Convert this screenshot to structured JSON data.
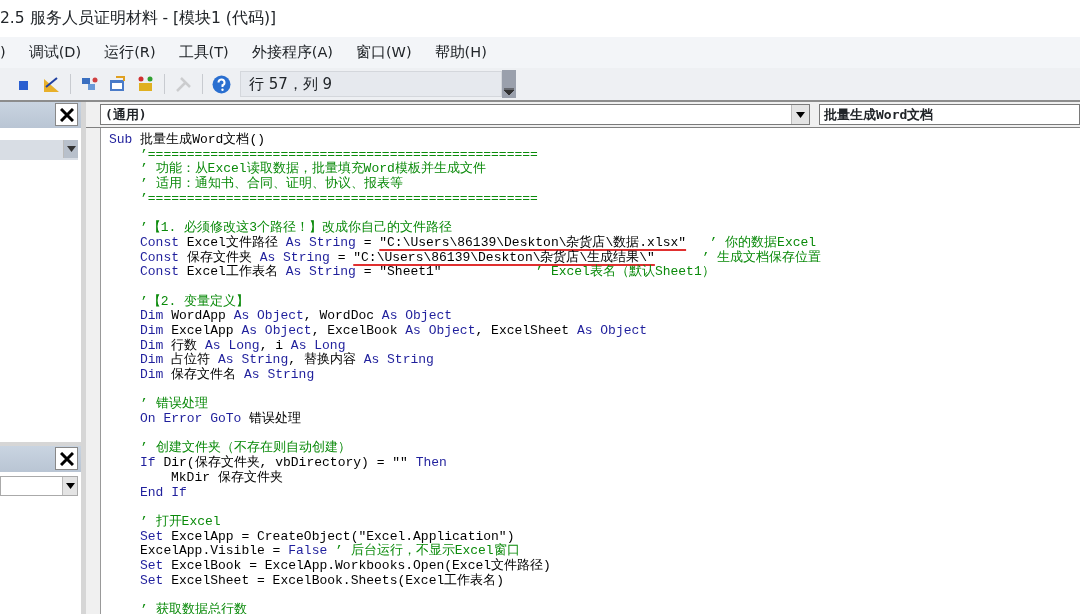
{
  "window": {
    "title": "2.5 服务人员证明材料 - [模块1 (代码)]"
  },
  "menu": [
    {
      "label": ")"
    },
    {
      "label": "调试(D)"
    },
    {
      "label": "运行(R)"
    },
    {
      "label": "工具(T)"
    },
    {
      "label": "外接程序(A)"
    },
    {
      "label": "窗口(W)"
    },
    {
      "label": "帮助(H)"
    }
  ],
  "toolbar": {
    "buttons": [
      {
        "kind": "reset",
        "disabled": false
      },
      {
        "kind": "design",
        "disabled": false
      },
      {
        "kind": "project",
        "disabled": false
      },
      {
        "kind": "properties",
        "disabled": false
      },
      {
        "kind": "browser",
        "disabled": false
      },
      {
        "kind": "toolbox",
        "disabled": true
      },
      {
        "kind": "help",
        "disabled": false
      }
    ],
    "position": "行 57，列 9"
  },
  "code_window": {
    "object_combo": "(通用)",
    "procedure_combo": "批量生成Word文档",
    "lines": [
      {
        "kind": "code",
        "tokens": [
          {
            "kind": "kw",
            "text": "Sub"
          },
          {
            "kind": "plain",
            "text": " 批量生成Word文档()"
          }
        ],
        "children": [
          {
            "kind": "code",
            "tokens": [
              {
                "kind": "comment",
                "text": "’=================================================="
              }
            ]
          },
          {
            "kind": "code",
            "tokens": [
              {
                "kind": "comment",
                "text": "’ 功能：从Excel读取数据，批量填充Word模板并生成文件"
              }
            ]
          },
          {
            "kind": "code",
            "tokens": [
              {
                "kind": "comment",
                "text": "’ 适用：通知书、合同、证明、协议、报表等"
              }
            ]
          },
          {
            "kind": "code",
            "tokens": [
              {
                "kind": "comment",
                "text": "’=================================================="
              }
            ]
          },
          {
            "kind": "blank"
          },
          {
            "kind": "code",
            "tokens": [
              {
                "kind": "comment",
                "text": "’【1. 必须修改这3个路径！】改成你自己的文件路径"
              }
            ]
          },
          {
            "kind": "code",
            "tokens": [
              {
                "kind": "kw",
                "text": "Const"
              },
              {
                "kind": "plain",
                "text": " Excel文件路径 "
              },
              {
                "kind": "kw",
                "text": "As String"
              },
              {
                "kind": "plain",
                "text": " = "
              },
              {
                "kind": "plain",
                "text": "\"C:\\Users\\86139\\Deskton\\杂货店\\数据.xlsx\"",
                "underlined": true
              },
              {
                "kind": "comment",
                "text": "   ’ 你的数据Excel"
              }
            ]
          },
          {
            "kind": "code",
            "tokens": [
              {
                "kind": "kw",
                "text": "Const"
              },
              {
                "kind": "plain",
                "text": " 保存文件夹 "
              },
              {
                "kind": "kw",
                "text": "As String"
              },
              {
                "kind": "plain",
                "text": " = "
              },
              {
                "kind": "plain",
                "text": "\"C:\\Users\\86139\\Deskton\\杂货店\\生成结果\\\"",
                "underlined": true
              },
              {
                "kind": "comment",
                "text": "      ’ 生成文档保存位置"
              }
            ]
          },
          {
            "kind": "code",
            "tokens": [
              {
                "kind": "kw",
                "text": "Const"
              },
              {
                "kind": "plain",
                "text": " Excel工作表名 "
              },
              {
                "kind": "kw",
                "text": "As String"
              },
              {
                "kind": "plain",
                "text": " = \"Sheet1\""
              },
              {
                "kind": "comment",
                "text": "            ’ Excel表名（默认Sheet1）"
              }
            ]
          },
          {
            "kind": "blank"
          },
          {
            "kind": "code",
            "tokens": [
              {
                "kind": "comment",
                "text": "’【2. 变量定义】"
              }
            ]
          },
          {
            "kind": "code",
            "tokens": [
              {
                "kind": "kw",
                "text": "Dim"
              },
              {
                "kind": "plain",
                "text": " WordApp "
              },
              {
                "kind": "kw",
                "text": "As Object"
              },
              {
                "kind": "plain",
                "text": ", WordDoc "
              },
              {
                "kind": "kw",
                "text": "As Object"
              }
            ]
          },
          {
            "kind": "code",
            "tokens": [
              {
                "kind": "kw",
                "text": "Dim"
              },
              {
                "kind": "plain",
                "text": " ExcelApp "
              },
              {
                "kind": "kw",
                "text": "As Object"
              },
              {
                "kind": "plain",
                "text": ", ExcelBook "
              },
              {
                "kind": "kw",
                "text": "As Object"
              },
              {
                "kind": "plain",
                "text": ", ExcelSheet "
              },
              {
                "kind": "kw",
                "text": "As Object"
              }
            ]
          },
          {
            "kind": "code",
            "tokens": [
              {
                "kind": "kw",
                "text": "Dim"
              },
              {
                "kind": "plain",
                "text": " 行数 "
              },
              {
                "kind": "kw",
                "text": "As Long"
              },
              {
                "kind": "plain",
                "text": ", i "
              },
              {
                "kind": "kw",
                "text": "As Long"
              }
            ]
          },
          {
            "kind": "code",
            "tokens": [
              {
                "kind": "kw",
                "text": "Dim"
              },
              {
                "kind": "plain",
                "text": " 占位符 "
              },
              {
                "kind": "kw",
                "text": "As String"
              },
              {
                "kind": "plain",
                "text": ", 替换内容 "
              },
              {
                "kind": "kw",
                "text": "As String"
              }
            ]
          },
          {
            "kind": "code",
            "tokens": [
              {
                "kind": "kw",
                "text": "Dim"
              },
              {
                "kind": "plain",
                "text": " 保存文件名 "
              },
              {
                "kind": "kw",
                "text": "As String"
              }
            ]
          },
          {
            "kind": "blank"
          },
          {
            "kind": "code",
            "tokens": [
              {
                "kind": "comment",
                "text": "’ 错误处理"
              }
            ]
          },
          {
            "kind": "code",
            "tokens": [
              {
                "kind": "kw",
                "text": "On Error GoTo"
              },
              {
                "kind": "plain",
                "text": " 错误处理"
              }
            ]
          },
          {
            "kind": "blank"
          },
          {
            "kind": "code",
            "tokens": [
              {
                "kind": "comment",
                "text": "’ 创建文件夹（不存在则自动创建）"
              }
            ]
          },
          {
            "kind": "code",
            "tokens": [
              {
                "kind": "kw",
                "text": "If"
              },
              {
                "kind": "plain",
                "text": " Dir(保存文件夹, vbDirectory) = \"\" "
              },
              {
                "kind": "kw",
                "text": "Then"
              }
            ],
            "children": [
              {
                "kind": "code",
                "tokens": [
                  {
                    "kind": "plain",
                    "text": "MkDir 保存文件夹"
                  }
                ]
              }
            ]
          },
          {
            "kind": "code",
            "tokens": [
              {
                "kind": "kw",
                "text": "End If"
              }
            ]
          },
          {
            "kind": "blank"
          },
          {
            "kind": "code",
            "tokens": [
              {
                "kind": "comment",
                "text": "’ 打开Excel"
              }
            ]
          },
          {
            "kind": "code",
            "tokens": [
              {
                "kind": "kw",
                "text": "Set"
              },
              {
                "kind": "plain",
                "text": " ExcelApp = CreateObject(\"Excel.Application\")"
              }
            ]
          },
          {
            "kind": "code",
            "tokens": [
              {
                "kind": "plain",
                "text": "ExcelApp.Visible = "
              },
              {
                "kind": "kw",
                "text": "False"
              },
              {
                "kind": "comment",
                "text": " ’ 后台运行，不显示Excel窗口"
              }
            ]
          },
          {
            "kind": "code",
            "tokens": [
              {
                "kind": "kw",
                "text": "Set"
              },
              {
                "kind": "plain",
                "text": " ExcelBook = ExcelApp.Workbooks.Open(Excel文件路径)"
              }
            ]
          },
          {
            "kind": "code",
            "tokens": [
              {
                "kind": "kw",
                "text": "Set"
              },
              {
                "kind": "plain",
                "text": " ExcelSheet = ExcelBook.Sheets(Excel工作表名)"
              }
            ]
          },
          {
            "kind": "blank"
          },
          {
            "kind": "code",
            "tokens": [
              {
                "kind": "comment",
                "text": "’ 获取数据总行数"
              }
            ]
          }
        ]
      }
    ]
  }
}
